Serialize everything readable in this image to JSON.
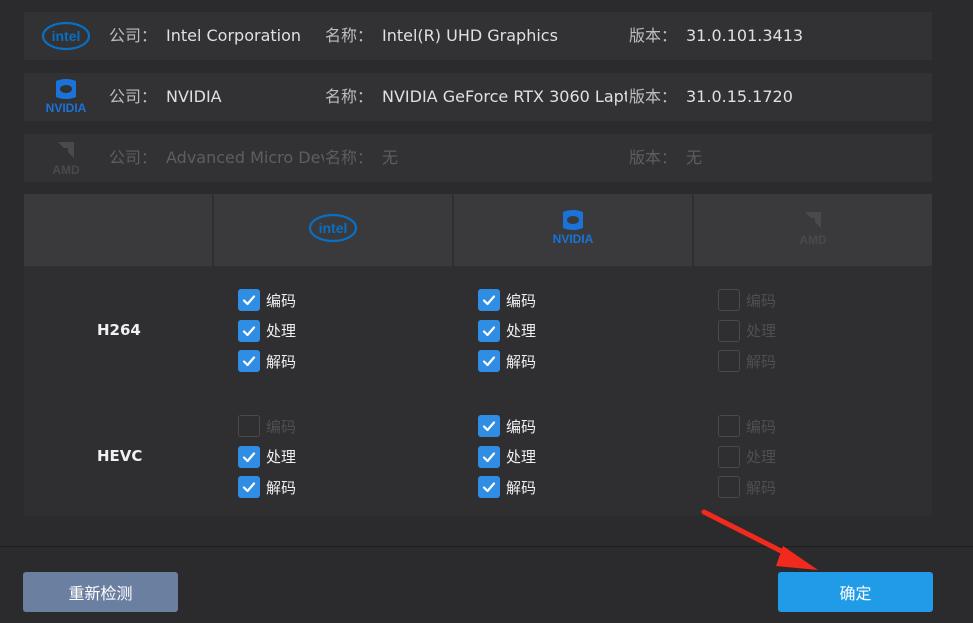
{
  "labels": {
    "company": "公司：",
    "name": "名称：",
    "version": "版本："
  },
  "gpus": [
    {
      "logo": "intel-logo",
      "logo_text": "intel",
      "company": "Intel Corporation",
      "name": "Intel(R) UHD Graphics",
      "version": "31.0.101.3413",
      "enabled": true,
      "brand_color": "#0a6fc2"
    },
    {
      "logo": "nvidia-logo",
      "logo_text": "NVIDIA",
      "company": "NVIDIA",
      "name": "NVIDIA GeForce RTX 3060 Lapt...",
      "version": "31.0.15.1720",
      "enabled": true,
      "brand_color": "#1a73d9"
    },
    {
      "logo": "amd-logo",
      "logo_text": "AMD",
      "company": "Advanced Micro Dev...",
      "name": "无",
      "version": "无",
      "enabled": false,
      "brand_color": "#4a4a4c"
    }
  ],
  "codecs": [
    {
      "label": "H264",
      "options": [
        {
          "gpu": "intel",
          "items": [
            {
              "text": "编码",
              "checked": true,
              "enabled": true
            },
            {
              "text": "处理",
              "checked": true,
              "enabled": true
            },
            {
              "text": "解码",
              "checked": true,
              "enabled": true
            }
          ]
        },
        {
          "gpu": "nvidia",
          "items": [
            {
              "text": "编码",
              "checked": true,
              "enabled": true
            },
            {
              "text": "处理",
              "checked": true,
              "enabled": true
            },
            {
              "text": "解码",
              "checked": true,
              "enabled": true
            }
          ]
        },
        {
          "gpu": "amd",
          "items": [
            {
              "text": "编码",
              "checked": false,
              "enabled": false
            },
            {
              "text": "处理",
              "checked": false,
              "enabled": false
            },
            {
              "text": "解码",
              "checked": false,
              "enabled": false
            }
          ]
        }
      ]
    },
    {
      "label": "HEVC",
      "options": [
        {
          "gpu": "intel",
          "items": [
            {
              "text": "编码",
              "checked": false,
              "enabled": false
            },
            {
              "text": "处理",
              "checked": true,
              "enabled": true
            },
            {
              "text": "解码",
              "checked": true,
              "enabled": true
            }
          ]
        },
        {
          "gpu": "nvidia",
          "items": [
            {
              "text": "编码",
              "checked": true,
              "enabled": true
            },
            {
              "text": "处理",
              "checked": true,
              "enabled": true
            },
            {
              "text": "解码",
              "checked": true,
              "enabled": true
            }
          ]
        },
        {
          "gpu": "amd",
          "items": [
            {
              "text": "编码",
              "checked": false,
              "enabled": false
            },
            {
              "text": "处理",
              "checked": false,
              "enabled": false
            },
            {
              "text": "解码",
              "checked": false,
              "enabled": false
            }
          ]
        }
      ]
    }
  ],
  "buttons": {
    "recheck": "重新检测",
    "ok": "确定"
  },
  "colors": {
    "accent": "#1f9be8",
    "checkbox": "#2f8de4",
    "annotation_arrow": "#f22a1e"
  }
}
